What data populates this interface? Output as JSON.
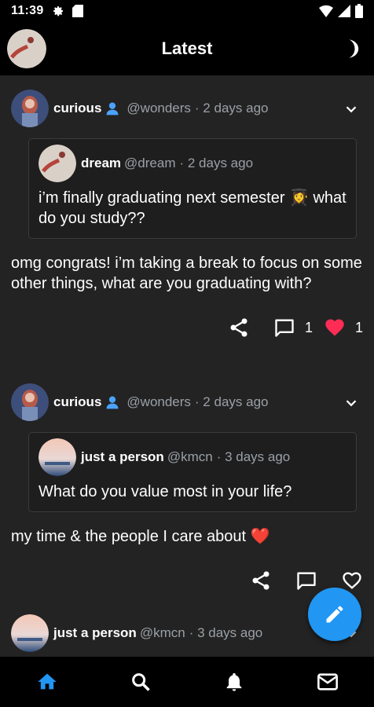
{
  "status_bar": {
    "time": "11:39",
    "left_icons": [
      "gear-icon",
      "sd-card-icon"
    ],
    "right_icons": [
      "wifi-icon",
      "signal-icon",
      "battery-icon"
    ]
  },
  "app_bar": {
    "title": "Latest",
    "left_icon": "profile-avatar",
    "right_icon": "moon-icon"
  },
  "posts": [
    {
      "author_name": "curious",
      "author_handle": "@wonders",
      "time": "· 2 days ago",
      "verified_icon": "person-icon",
      "quote": {
        "author_name": "dream",
        "author_handle": "@dream",
        "time": "· 2 days ago",
        "text": "i’m finally graduating next semester 👩‍🎓 what do you study??"
      },
      "body": "omg congrats! i’m taking a break to focus on some other things, what are you graduating with?",
      "comment_count": "1",
      "like_count": "1"
    },
    {
      "author_name": "curious",
      "author_handle": "@wonders",
      "time": "· 2 days ago",
      "verified_icon": "person-icon",
      "quote": {
        "author_name": "just a person",
        "author_handle": "@kmcn",
        "time": "· 3 days ago",
        "text": "What do you value most in your life?"
      },
      "body": "my time & the people I care about ❤️"
    },
    {
      "author_name": "just a person",
      "author_handle": "@kmcn",
      "time": "· 3 days ago"
    }
  ],
  "bottom_nav": [
    "home-icon",
    "search-icon",
    "bell-icon",
    "mail-icon"
  ],
  "colors": {
    "accent": "#2196f3",
    "heart": "#ff2d55",
    "background": "#232323",
    "bars": "#000000",
    "muted": "#9aa0a6"
  }
}
